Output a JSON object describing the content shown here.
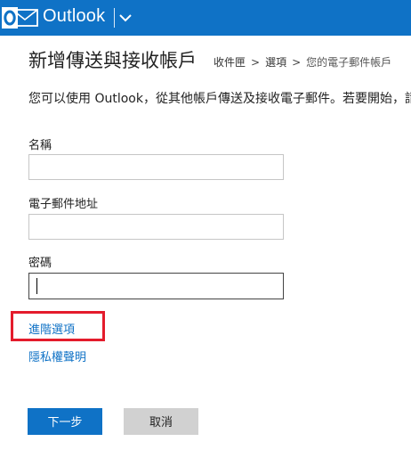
{
  "app": {
    "name": "Outlook",
    "accent": "#0f72c6"
  },
  "page": {
    "title": "新增傳送與接收帳戶",
    "breadcrumb": {
      "items": [
        "收件匣",
        "選項",
        "您的電子郵件帳戶"
      ],
      "separator": ">"
    },
    "intro": "您可以使用 Outlook，從其他帳戶傳送及接收電子郵件。若要開始，請"
  },
  "form": {
    "name_label": "名稱",
    "name_value": "",
    "email_label": "電子郵件地址",
    "email_value": "",
    "password_label": "密碼",
    "password_value": ""
  },
  "links": {
    "advanced": "進階選項",
    "privacy": "隱私權聲明"
  },
  "buttons": {
    "next": "下一步",
    "cancel": "取消"
  },
  "colors": {
    "highlight": "#e41c2c",
    "link": "#0f72c6",
    "cancel_bg": "#d1d1d1"
  }
}
